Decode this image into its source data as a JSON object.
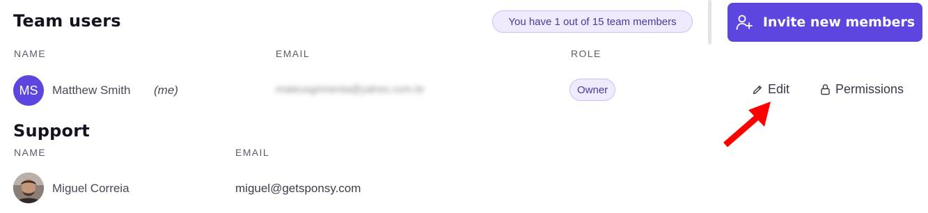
{
  "team_section": {
    "title": "Team users",
    "members_badge": "You have 1 out of 15 team members",
    "invite_button_label": "Invite new members",
    "columns": {
      "name": "NAME",
      "email": "EMAIL",
      "role": "ROLE"
    },
    "rows": [
      {
        "initials": "MS",
        "name": "Matthew Smith",
        "me_tag": "(me)",
        "email": "mateusgrimenta@yahoo.com.br",
        "role": "Owner",
        "edit_label": "Edit",
        "permissions_label": "Permissions"
      }
    ]
  },
  "support_section": {
    "title": "Support",
    "columns": {
      "name": "NAME",
      "email": "EMAIL"
    },
    "rows": [
      {
        "name": "Miguel Correia",
        "email": "miguel@getsponsy.com"
      }
    ]
  },
  "colors": {
    "accent": "#5b46e0",
    "badge_bg": "#efeafe",
    "annotation_arrow": "#ff0000"
  },
  "icons": {
    "invite": "user-plus-icon",
    "edit": "pencil-icon",
    "permissions": "lock-icon"
  }
}
